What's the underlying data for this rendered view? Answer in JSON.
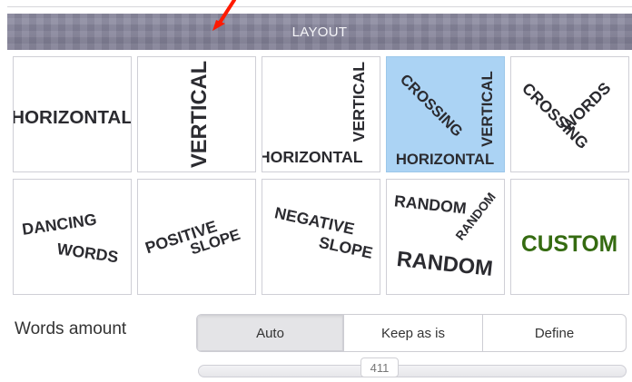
{
  "panel": {
    "title": "LAYOUT"
  },
  "layouts": [
    {
      "id": "horizontal",
      "lines": [
        "Horizontal"
      ],
      "selected": false
    },
    {
      "id": "vertical",
      "lines": [
        "Vertical"
      ],
      "selected": false
    },
    {
      "id": "vertical-horizontal",
      "lines": [
        "Vertical",
        "Horizontal"
      ],
      "selected": false
    },
    {
      "id": "crossing-vertical-horizontal",
      "lines": [
        "Crossing",
        "Vertical",
        "Horizontal"
      ],
      "selected": true
    },
    {
      "id": "crossing-words",
      "lines": [
        "Crossing",
        "Words"
      ],
      "selected": false
    },
    {
      "id": "dancing-words",
      "lines": [
        "Dancing",
        "Words"
      ],
      "selected": false
    },
    {
      "id": "positive-slope",
      "lines": [
        "Positive",
        "Slope"
      ],
      "selected": false
    },
    {
      "id": "negative-slope",
      "lines": [
        "Negative",
        "Slope"
      ],
      "selected": false
    },
    {
      "id": "random",
      "lines": [
        "Random",
        "Random",
        "Random"
      ],
      "selected": false
    },
    {
      "id": "custom",
      "lines": [
        "Custom"
      ],
      "selected": false
    }
  ],
  "words_amount": {
    "label": "Words amount",
    "options": [
      "Auto",
      "Keep as is",
      "Define"
    ],
    "selected": "Auto",
    "value": "411"
  },
  "colors": {
    "header": "#7f7d93",
    "selected_tile": "#abd3f4",
    "custom_text": "#356b11",
    "tile_text": "#2b2b30",
    "annotation_arrow": "#ff1a00"
  }
}
